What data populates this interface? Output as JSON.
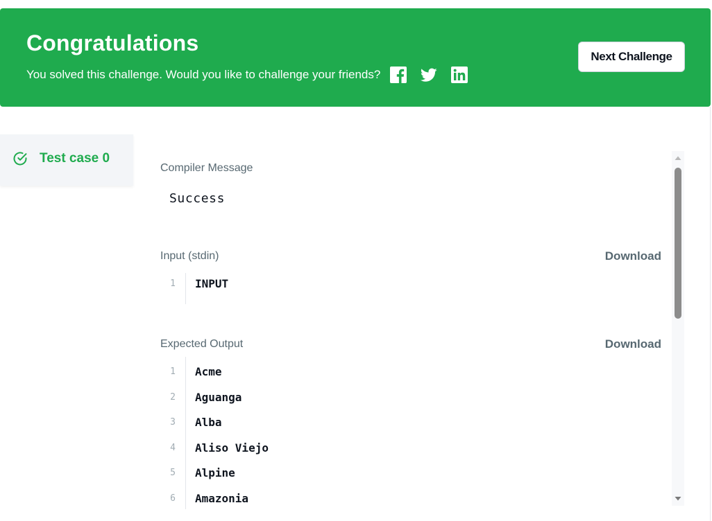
{
  "banner": {
    "title": "Congratulations",
    "subtitle": "You solved this challenge. Would you like to challenge your friends?",
    "next_button": "Next Challenge",
    "social_icons": [
      "facebook-icon",
      "twitter-icon",
      "linkedin-icon"
    ],
    "color": "#1fab4e"
  },
  "sidebar": {
    "test_case_label": "Test case 0",
    "status": "passed",
    "status_color": "#1fab4e"
  },
  "results": {
    "compiler": {
      "label": "Compiler Message",
      "message": "Success"
    },
    "input": {
      "label": "Input (stdin)",
      "download_label": "Download",
      "lines": [
        {
          "num": "1",
          "text": "INPUT"
        }
      ]
    },
    "expected": {
      "label": "Expected Output",
      "download_label": "Download",
      "lines": [
        {
          "num": "1",
          "text": "Acme"
        },
        {
          "num": "2",
          "text": "Aguanga"
        },
        {
          "num": "3",
          "text": "Alba"
        },
        {
          "num": "4",
          "text": "Aliso Viejo"
        },
        {
          "num": "5",
          "text": "Alpine"
        },
        {
          "num": "6",
          "text": "Amazonia"
        }
      ]
    }
  }
}
